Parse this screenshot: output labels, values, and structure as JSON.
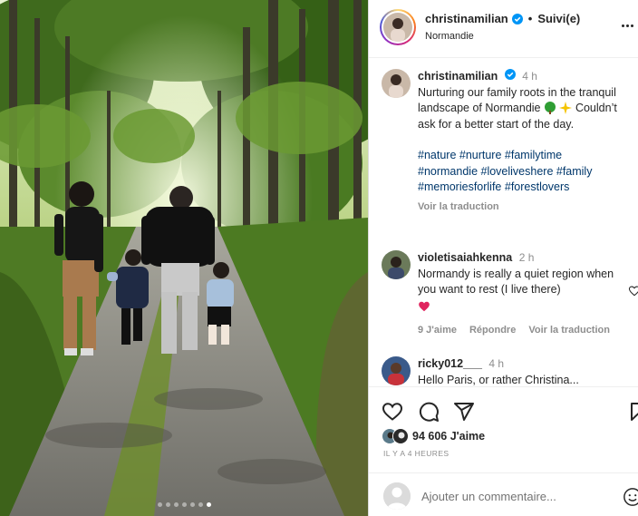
{
  "post": {
    "author": "christinamilian",
    "follow_label": "Suivi(e)",
    "separator": "•",
    "location": "Normandie",
    "photo_alt": "Family walking on a forest path"
  },
  "caption": {
    "username": "christinamilian",
    "time": "4 h",
    "text": "Nurturing our family roots in the tranquil landscape of Normandie",
    "text2": "Couldn’t ask for a better start of the day.",
    "emoji_1": "tree-emoji",
    "emoji_2": "sparkle-emoji",
    "hashtags_line1": "#nature #nurture #familytime",
    "hashtags_line2": "#normandie #loveliveshere #family",
    "hashtags_line3": "#memoriesforlife #forestlovers",
    "translate": "Voir la traduction"
  },
  "comments": [
    {
      "username": "violetisaiahkenna",
      "time": "2 h",
      "text": "Normandy is really a quiet region when you want to rest (I live there)",
      "emoji": "red-heart",
      "likes": "9 J'aime",
      "reply": "Répondre",
      "translate": "Voir la traduction"
    },
    {
      "username": "ricky012___",
      "time": "4 h",
      "text": "Hello Paris, or rather Christina..."
    }
  ],
  "stats": {
    "likes": "94 606 J'aime",
    "ago": "Il y a 4 heures"
  },
  "add_comment": {
    "placeholder": "Ajouter un commentaire..."
  },
  "icons": {
    "like": "heart-icon",
    "comment": "comment-icon",
    "share": "paper-plane-icon",
    "save": "bookmark-icon",
    "more": "more-horizontal-icon",
    "emoji": "smiley-icon",
    "verified": "verified-badge-icon"
  },
  "colors": {
    "link": "#00376b",
    "verified": "#0095f6",
    "muted": "#8e8e8e",
    "text": "#262626"
  },
  "carousel": {
    "slides": 7,
    "active": 7
  }
}
